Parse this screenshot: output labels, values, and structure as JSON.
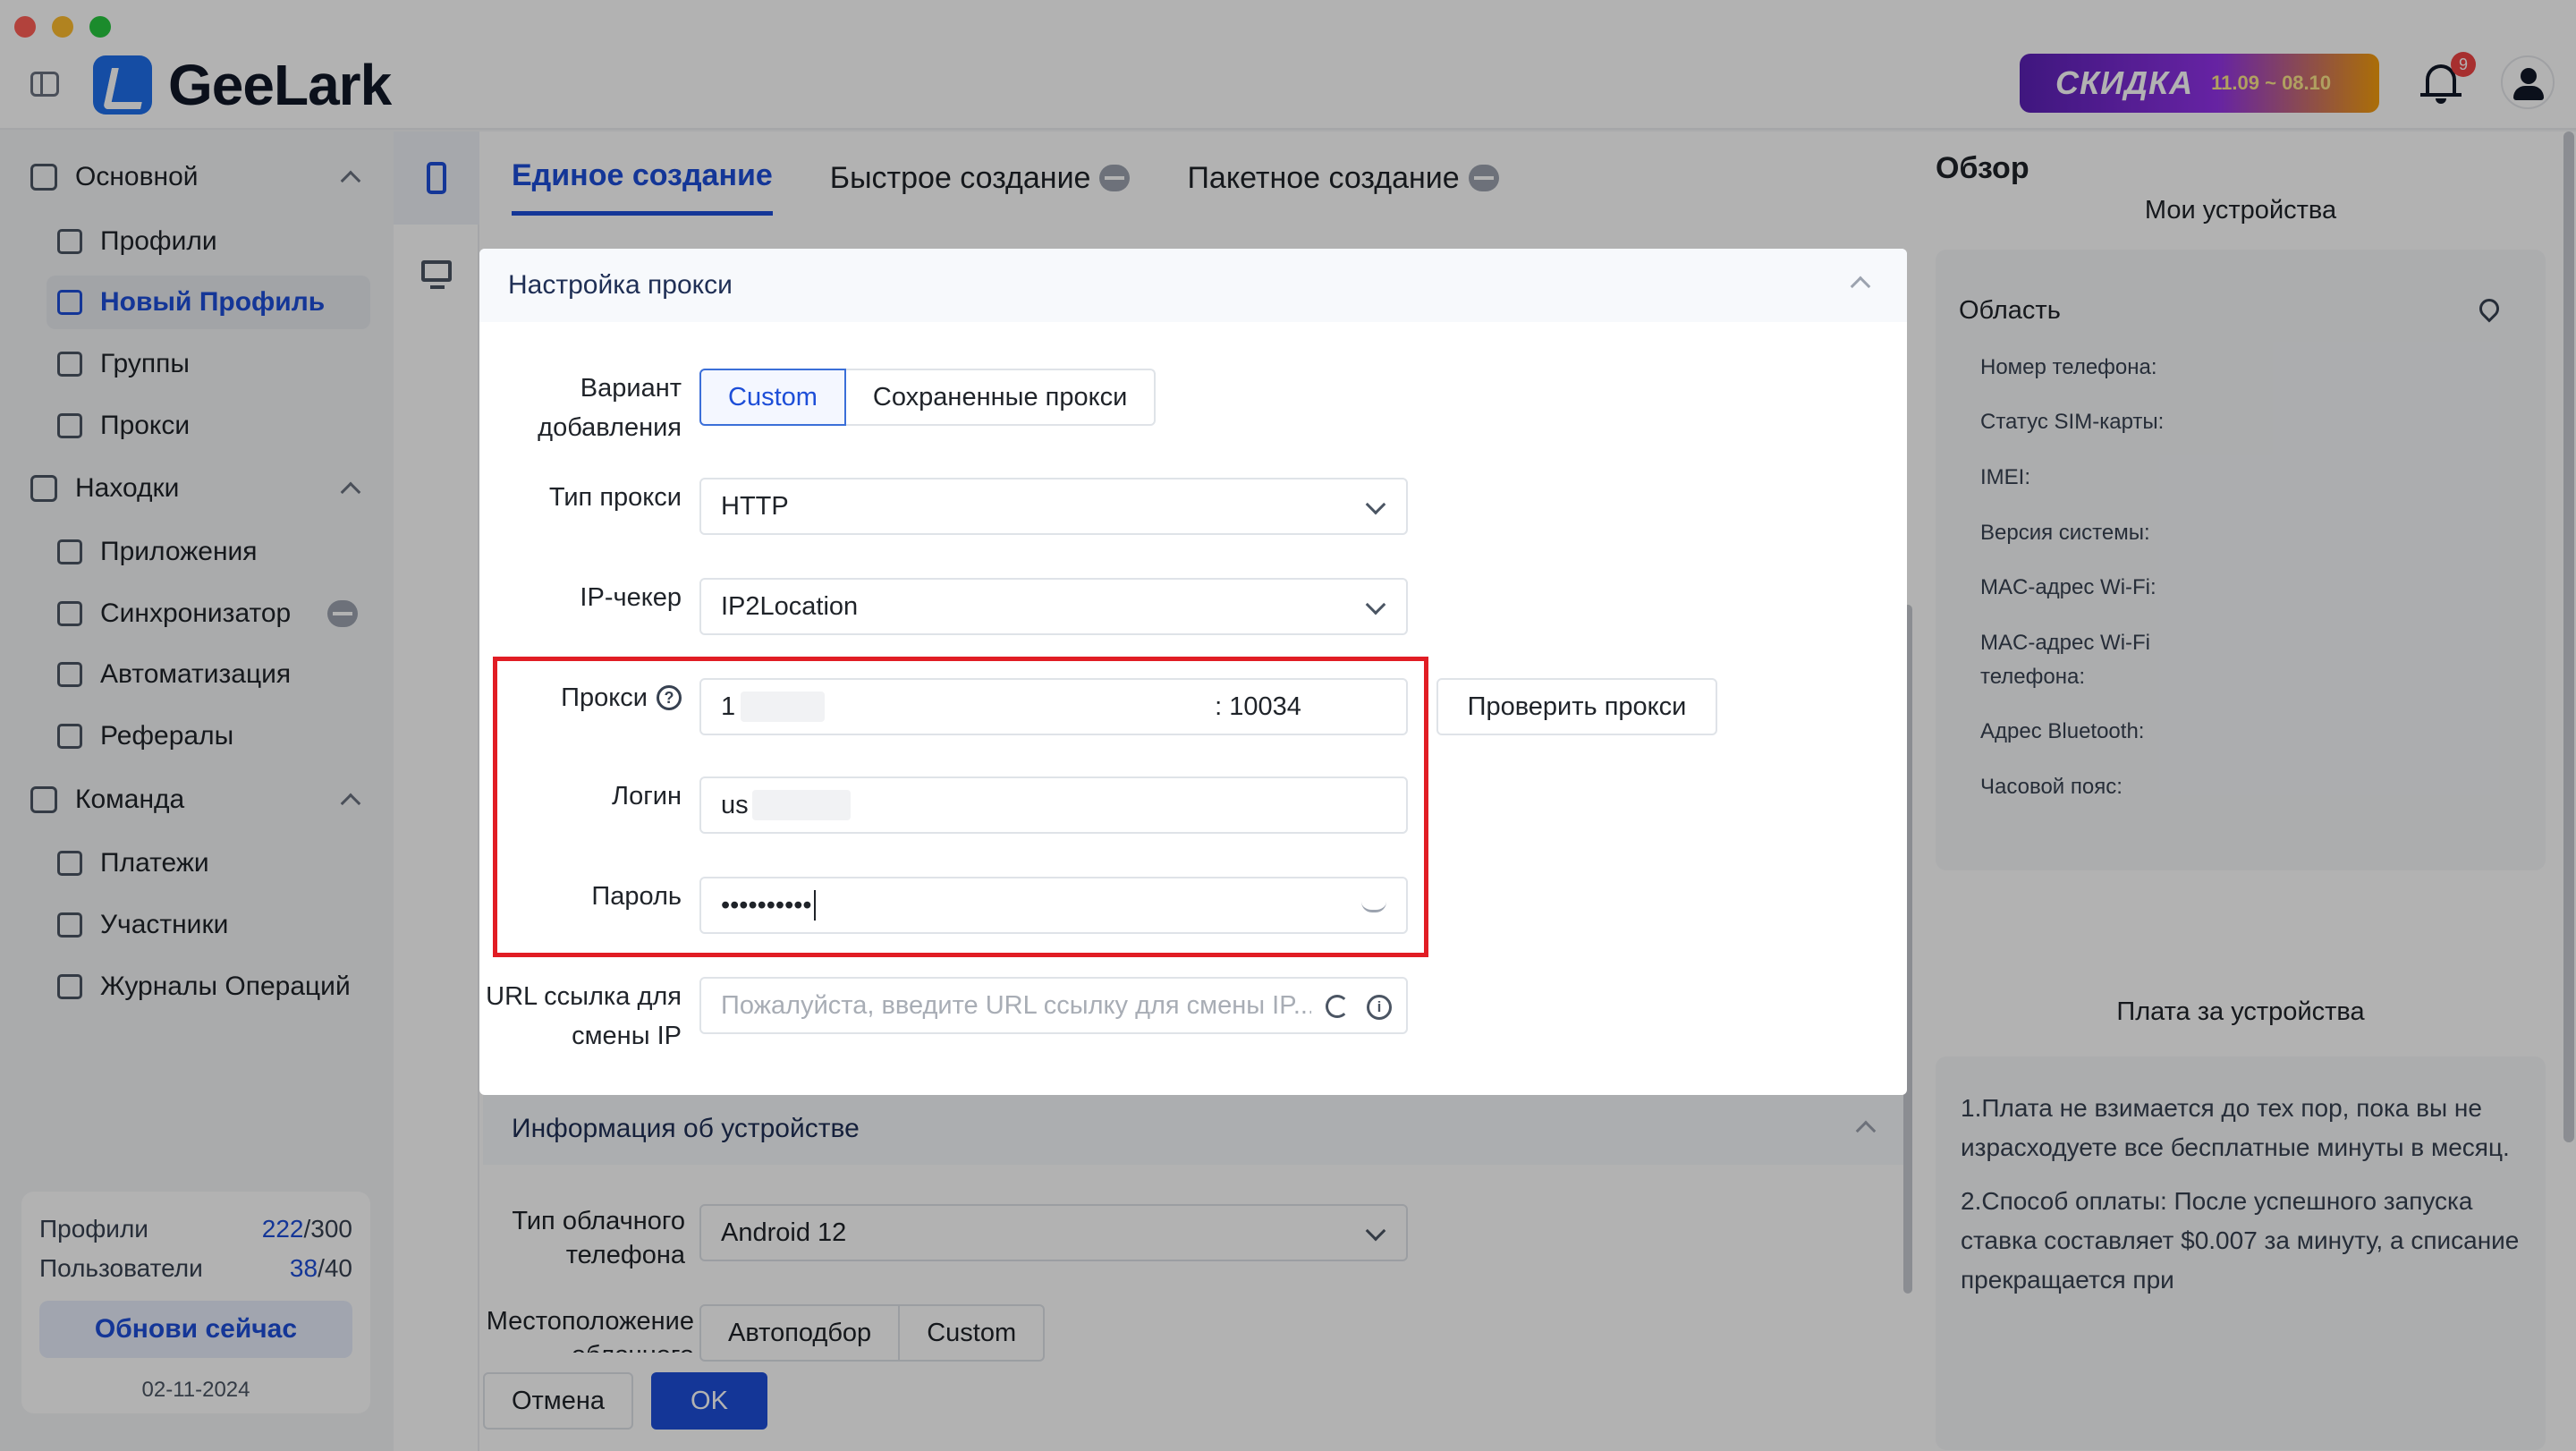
{
  "app": {
    "brand": "GeeLark",
    "promo_title": "СКИДКА",
    "promo_dates": "11.09 ~ 08.10",
    "notification_count": "9"
  },
  "sidebar": {
    "groups": [
      {
        "label": "Основной",
        "items": [
          "Профили",
          "Новый Профиль",
          "Группы",
          "Прокси"
        ]
      },
      {
        "label": "Находки",
        "items": [
          "Приложения",
          "Синхронизатор",
          "Автоматизация",
          "Рефералы"
        ]
      },
      {
        "label": "Команда",
        "items": [
          "Платежи",
          "Участники",
          "Журналы Операций"
        ]
      }
    ],
    "active_item": "Новый Профиль",
    "usage": {
      "profiles_label": "Профили",
      "profiles_used": "222",
      "profiles_total": "/300",
      "users_label": "Пользователи",
      "users_used": "38",
      "users_total": "/40",
      "update_button": "Обнови сейчас",
      "date": "02-11-2024"
    }
  },
  "main": {
    "tabs": [
      "Единое создание",
      "Быстрое создание",
      "Пакетное создание"
    ],
    "active_tab": "Единое создание",
    "device_section": {
      "title": "Информация об устройстве",
      "cloud_type_label": "Тип облачного телефона",
      "cloud_type_value": "Android 12",
      "location_label": "Местоположение облачного",
      "location_options": [
        "Автоподбор",
        "Custom"
      ]
    },
    "cancel_button": "Отмена",
    "ok_button": "OK"
  },
  "proxy_panel": {
    "title": "Настройка прокси",
    "add_variant_label": "Вариант добавления",
    "add_variant_options": [
      "Custom",
      "Сохраненные прокси"
    ],
    "add_variant_selected": "Custom",
    "proxy_type_label": "Тип прокси",
    "proxy_type_value": "HTTP",
    "ip_checker_label": "IP-чекер",
    "ip_checker_value": "IP2Location",
    "proxy_label": "Прокси",
    "proxy_host_visible": "1",
    "proxy_port": ": 10034",
    "check_proxy_button": "Проверить прокси",
    "login_label": "Логин",
    "login_visible": "us",
    "password_label": "Пароль",
    "password_mask": "••••••••••",
    "url_label": "URL ссылка для смены IP",
    "url_placeholder": "Пожалуйста, введите URL ссылку для смены IP..."
  },
  "overview": {
    "title": "Обзор",
    "subtitle": "Мои устройства",
    "region_label": "Область",
    "fields": [
      "Номер телефона:",
      "Статус SIM-карты:",
      "IMEI:",
      "Версия системы:",
      "MAC-адрес Wi-Fi:",
      "MAC-адрес Wi-Fi телефона:",
      "Адрес Bluetooth:",
      "Часовой пояс:"
    ],
    "fee_title": "Плата за устройства",
    "fee_notes": [
      "1.Плата не взимается до тех пор, пока вы не израсходуете все бесплатные минуты в месяц.",
      "2.Способ оплаты: После успешного запуска ставка составляет $0.007 за минуту, а списание прекращается при"
    ]
  },
  "colors": {
    "accent": "#1d4ed8",
    "highlight": "#e11d24"
  }
}
